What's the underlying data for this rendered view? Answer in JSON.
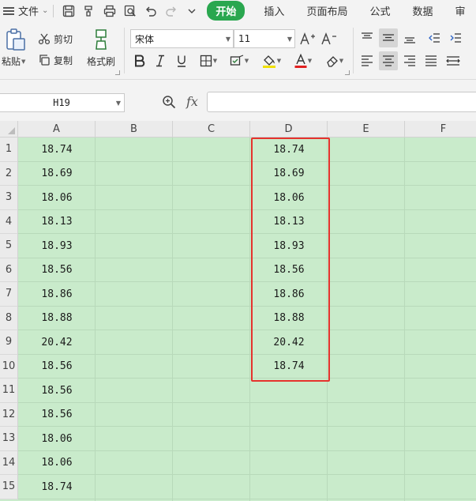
{
  "menubar": {
    "file_label": "文件",
    "quick_tools": [
      "save-icon",
      "format-painter-quick-icon",
      "print-icon",
      "print-preview-icon",
      "undo-icon",
      "redo-icon",
      "more-chevron-icon"
    ],
    "tabs": [
      {
        "label": "开始",
        "active": true
      },
      {
        "label": "插入",
        "active": false
      },
      {
        "label": "页面布局",
        "active": false
      },
      {
        "label": "公式",
        "active": false
      },
      {
        "label": "数据",
        "active": false
      },
      {
        "label": "审",
        "active": false
      }
    ]
  },
  "ribbon": {
    "paste_label": "粘贴",
    "cut_label": "剪切",
    "copy_label": "复制",
    "format_painter_label": "格式刷",
    "font_name": "宋体",
    "font_size": "11",
    "font_color": "#e02020",
    "fill_color": "#f0e000"
  },
  "formula_bar": {
    "name_box": "H19",
    "fx_label": "fx",
    "formula": ""
  },
  "sheet": {
    "columns": [
      "A",
      "B",
      "C",
      "D",
      "E",
      "F"
    ],
    "rows": [
      "1",
      "2",
      "3",
      "4",
      "5",
      "6",
      "7",
      "8",
      "9",
      "10",
      "11",
      "12",
      "13",
      "14",
      "15"
    ],
    "col_a": [
      "18.74",
      "18.69",
      "18.06",
      "18.13",
      "18.93",
      "18.56",
      "18.86",
      "18.88",
      "20.42",
      "18.56",
      "18.56",
      "18.56",
      "18.06",
      "18.06",
      "18.74"
    ],
    "col_d": [
      "18.74",
      "18.69",
      "18.06",
      "18.13",
      "18.93",
      "18.56",
      "18.86",
      "18.88",
      "20.42",
      "18.74"
    ],
    "cell_background": "#c9ebcb",
    "highlight_color": "#e5322d"
  }
}
